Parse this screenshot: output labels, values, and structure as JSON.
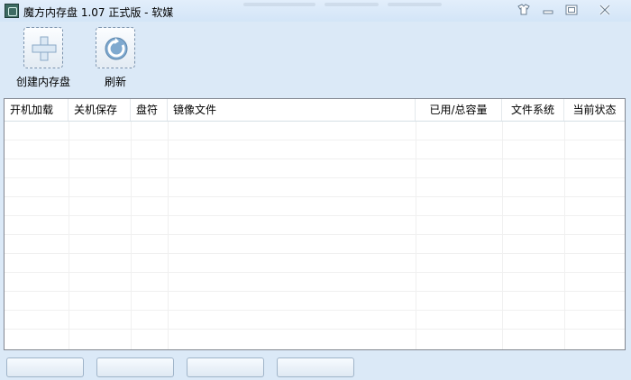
{
  "window": {
    "title": "魔方内存盘 1.07 正式版 - 软媒",
    "controls": [
      "skin-icon",
      "minimize-icon",
      "maximize-icon",
      "close-icon"
    ]
  },
  "toolbar": {
    "create_label": "创建内存盘",
    "refresh_label": "刷新"
  },
  "table": {
    "columns": [
      "开机加载",
      "关机保存",
      "盘符",
      "镜像文件",
      "已用/总容量",
      "文件系统",
      "当前状态"
    ],
    "rows": []
  },
  "bottom_buttons": [
    "",
    "",
    "",
    ""
  ],
  "colors": {
    "titlebar": "#d3e5f7",
    "frame": "#dbe9f7",
    "table_border": "#828790",
    "icon_accent": "#7fa9cf"
  }
}
